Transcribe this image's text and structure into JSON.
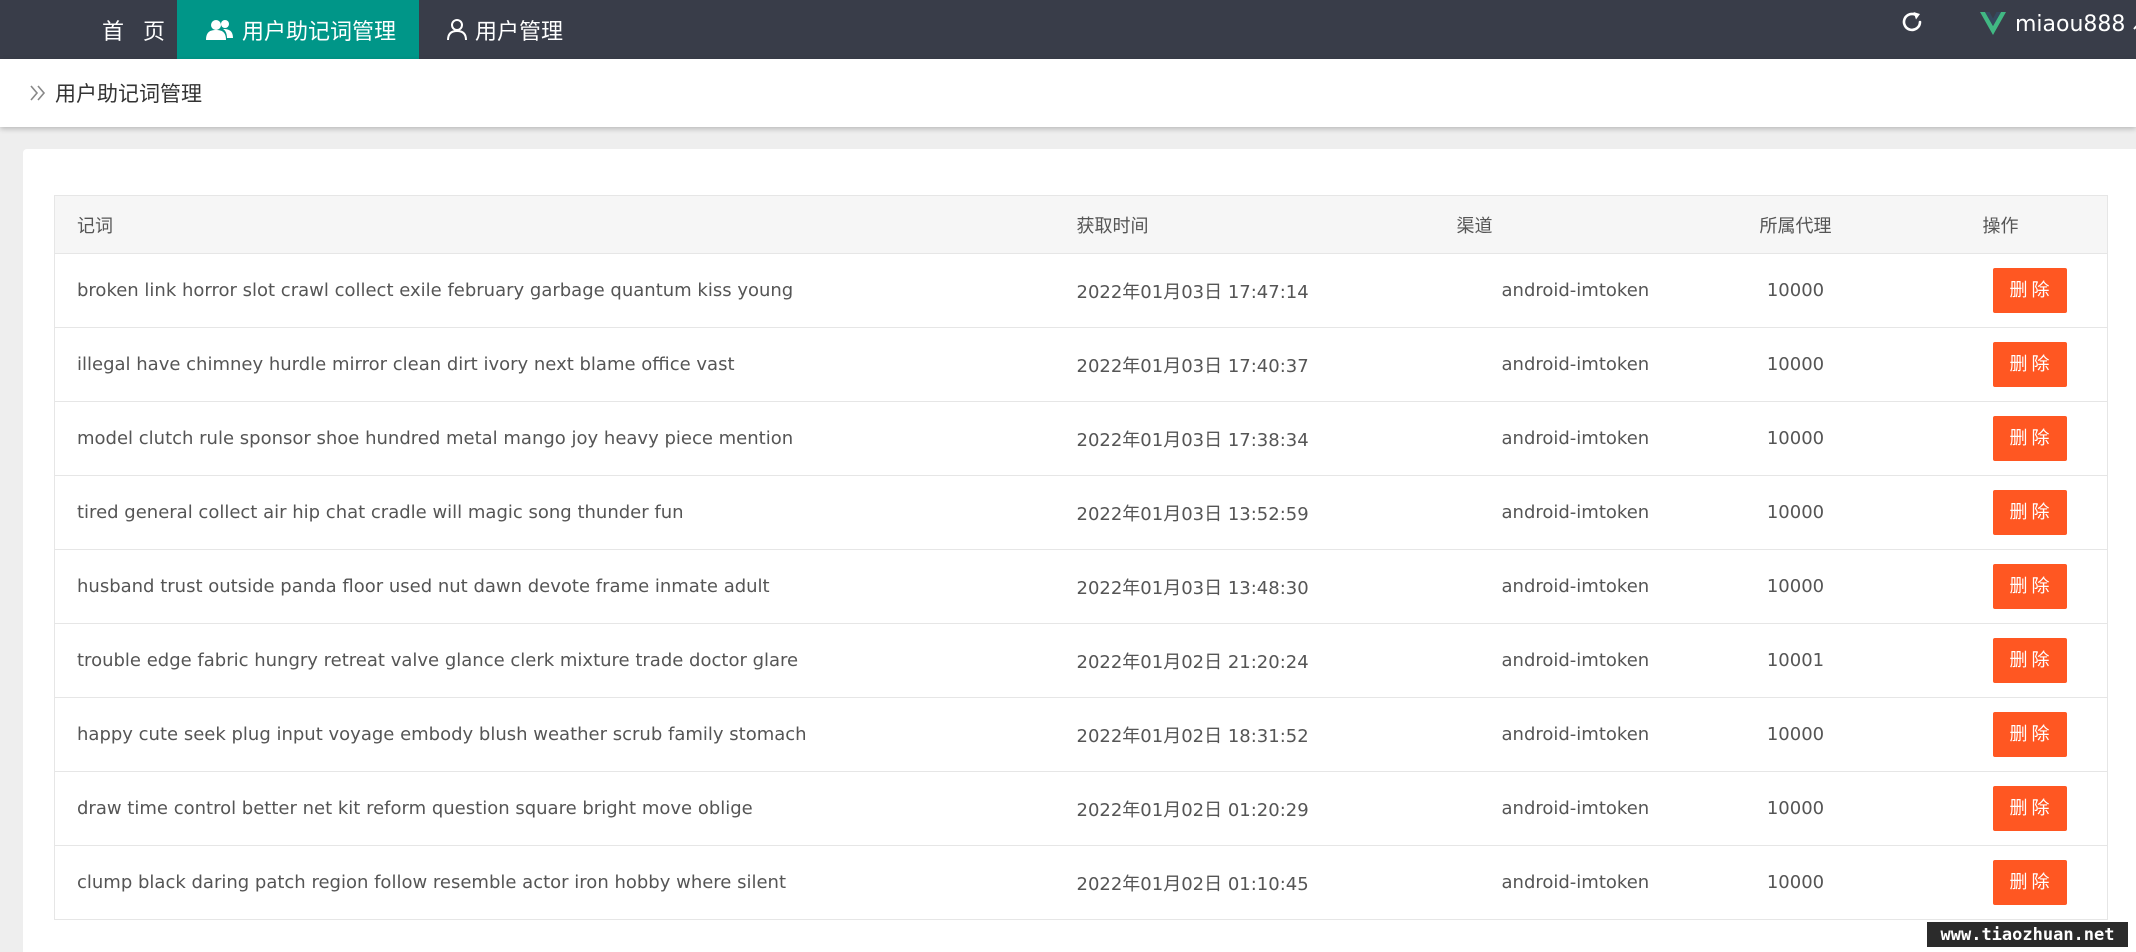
{
  "nav": {
    "home": "首 页",
    "mnemonic_mgmt": "用户助记词管理",
    "user_mgmt": "用户管理",
    "account": "miaou888",
    "icons": {
      "mnemonic": "users-icon",
      "user": "user-icon",
      "refresh": "refresh-icon",
      "logo": "vue-logo-icon",
      "caret": "chevron-up-icon"
    }
  },
  "breadcrumb": {
    "text": "用户助记词管理"
  },
  "table": {
    "headers": [
      "记词",
      "获取时间",
      "渠道",
      "所属代理",
      "操作"
    ],
    "delete_label": "删除",
    "rows": [
      {
        "words": "broken link horror slot crawl collect exile february garbage quantum kiss young",
        "time": "2022年01月03日 17:47:14",
        "channel": "android-imtoken",
        "agent": "10000"
      },
      {
        "words": "illegal have chimney hurdle mirror clean dirt ivory next blame office vast",
        "time": "2022年01月03日 17:40:37",
        "channel": "android-imtoken",
        "agent": "10000"
      },
      {
        "words": "model clutch rule sponsor shoe hundred metal mango joy heavy piece mention",
        "time": "2022年01月03日 17:38:34",
        "channel": "android-imtoken",
        "agent": "10000"
      },
      {
        "words": "tired general collect air hip chat cradle will magic song thunder fun",
        "time": "2022年01月03日 13:52:59",
        "channel": "android-imtoken",
        "agent": "10000"
      },
      {
        "words": "husband trust outside panda floor used nut dawn devote frame inmate adult",
        "time": "2022年01月03日 13:48:30",
        "channel": "android-imtoken",
        "agent": "10000"
      },
      {
        "words": "trouble edge fabric hungry retreat valve glance clerk mixture trade doctor glare",
        "time": "2022年01月02日 21:20:24",
        "channel": "android-imtoken",
        "agent": "10001"
      },
      {
        "words": "happy cute seek plug input voyage embody blush weather scrub family stomach",
        "time": "2022年01月02日 18:31:52",
        "channel": "android-imtoken",
        "agent": "10000"
      },
      {
        "words": "draw time control better net kit reform question square bright move oblige",
        "time": "2022年01月02日 01:20:29",
        "channel": "android-imtoken",
        "agent": "10000"
      },
      {
        "words": "clump black daring patch region follow resemble actor iron hobby where silent",
        "time": "2022年01月02日 01:10:45",
        "channel": "android-imtoken",
        "agent": "10000"
      }
    ]
  },
  "watermark": "www.tiaozhuan.net",
  "colors": {
    "topbar": "#393d49",
    "active_nav": "#009688",
    "danger": "#ff5722",
    "vue_green": "#41b883"
  }
}
